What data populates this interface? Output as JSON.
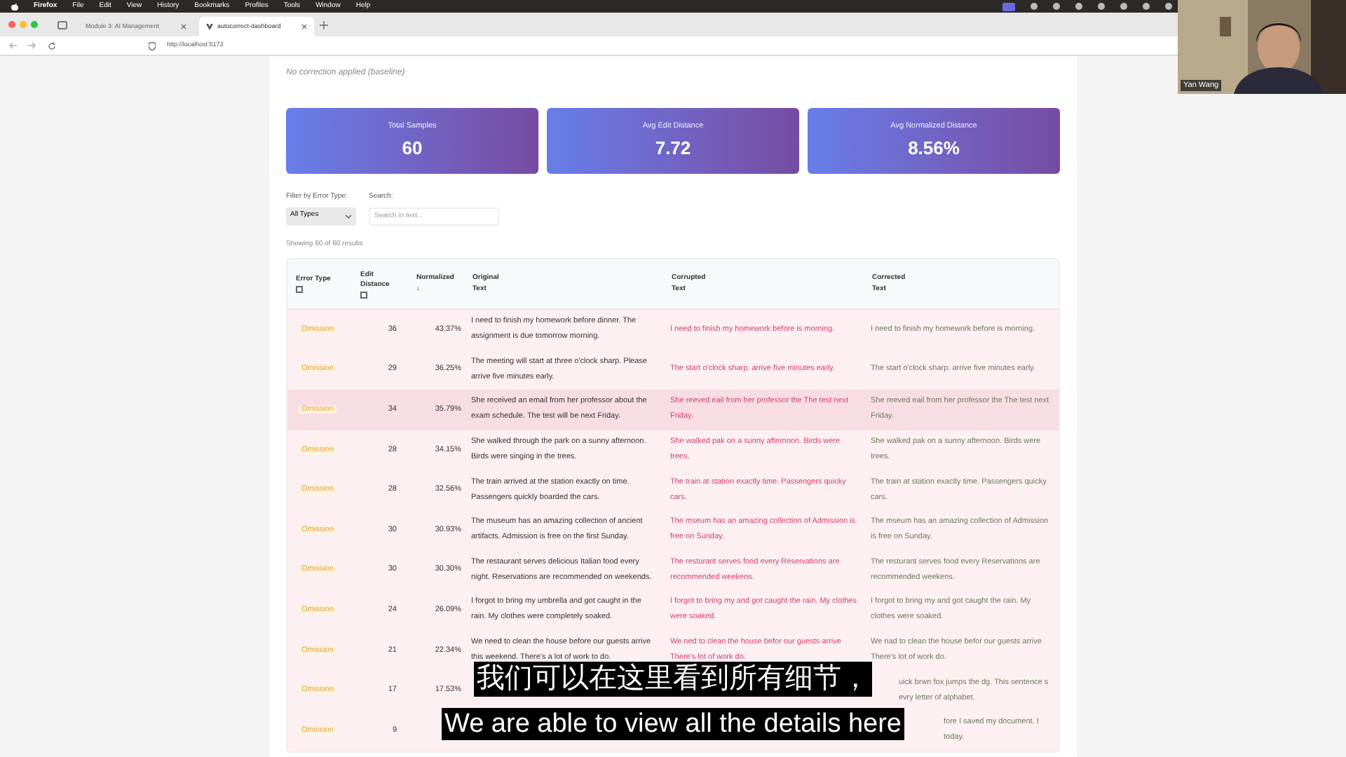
{
  "menu_bar": {
    "app": "Firefox",
    "items": [
      "File",
      "Edit",
      "View",
      "History",
      "Bookmarks",
      "Profiles",
      "Tools",
      "Window",
      "Help"
    ]
  },
  "tabs": [
    {
      "label": "Module 3: AI Management",
      "selected": false
    },
    {
      "label": "autocorrect-dashboard",
      "selected": true
    }
  ],
  "url": "http://localhost:5173",
  "page": {
    "subtitle": "No correction applied (baseline)",
    "stats": [
      {
        "label": "Total Samples",
        "value": "60"
      },
      {
        "label": "Avg Edit Distance",
        "value": "7.72"
      },
      {
        "label": "Avg Normalized Distance",
        "value": "8.56%"
      }
    ],
    "filters": {
      "type_label": "Filter by Error Type:",
      "type_value": "All Types",
      "search_label": "Search:",
      "search_placeholder": "Search in text..."
    },
    "showing": "Showing 60 of 60 results",
    "table": {
      "columns": [
        {
          "label": "Error Type",
          "sort_icon": true
        },
        {
          "label": "Edit Distance",
          "sort_icon": true
        },
        {
          "label": "Normalized",
          "sort_arrow": "↓"
        },
        {
          "label": "Original Text"
        },
        {
          "label": "Corrupted Text"
        },
        {
          "label": "Corrected Text"
        }
      ],
      "rows": [
        {
          "kind": "full",
          "highlighted": false,
          "error_type": "Omission",
          "edit_distance": "36",
          "normalized": "43.37%",
          "original": "I need to finish my homework before dinner. The assignment is due tomorrow morning.",
          "corrupted": "I need to finish my homework before is morning.",
          "corrected": "I need to finish my homework before is morning."
        },
        {
          "kind": "full",
          "highlighted": false,
          "error_type": "Omission",
          "edit_distance": "29",
          "normalized": "36.25%",
          "original": "The meeting will start at three o'clock sharp. Please arrive five minutes early.",
          "corrupted": "The start o'clock sharp. arrive five minutes early.",
          "corrected": "The start o'clock sharp. arrive five minutes early."
        },
        {
          "kind": "full",
          "highlighted": true,
          "error_type": "Omission",
          "edit_distance": "34",
          "normalized": "35.79%",
          "original": "She received an email from her professor about the exam schedule. The test will be next Friday.",
          "corrupted": "She reeved eail from her professor the The test next Friday.",
          "corrected": "She reeved eail from her professor the The test next Friday."
        },
        {
          "kind": "full",
          "highlighted": false,
          "error_type": "Omission",
          "edit_distance": "28",
          "normalized": "34.15%",
          "original": "She walked through the park on a sunny afternoon. Birds were singing in the trees.",
          "corrupted": "She walked pak on a sunny afternoon. Birds were trees.",
          "corrected": "She walked pak on a sunny afternoon. Birds were trees."
        },
        {
          "kind": "full",
          "highlighted": false,
          "error_type": "Omission",
          "edit_distance": "28",
          "normalized": "32.56%",
          "original": "The train arrived at the station exactly on time. Passengers quickly boarded the cars.",
          "corrupted": "The train at station exactly time. Passengers quicky cars.",
          "corrected": "The train at station exactly time. Passengers quicky cars."
        },
        {
          "kind": "full",
          "highlighted": false,
          "error_type": "Omission",
          "edit_distance": "30",
          "normalized": "30.93%",
          "original": "The museum has an amazing collection of ancient artifacts. Admission is free on the first Sunday.",
          "corrupted": "The mseum has an amazing collection of Admission is free on Sunday.",
          "corrected": "The mseum has an amazing collection of Admission is free on Sunday."
        },
        {
          "kind": "full",
          "highlighted": false,
          "error_type": "Omission",
          "edit_distance": "30",
          "normalized": "30.30%",
          "original": "The restaurant serves delicious Italian food every night. Reservations are recommended on weekends.",
          "corrupted": "The resturant serves food every Reservations are recommended weekens.",
          "corrected": "The resturant serves food every Reservations are recommended weekens."
        },
        {
          "kind": "full",
          "highlighted": false,
          "error_type": "Omission",
          "edit_distance": "24",
          "normalized": "26.09%",
          "original": "I forgot to bring my umbrella and got caught in the rain. My clothes were completely soaked.",
          "corrupted": "I forgot to bring my and got caught the rain. My clothes were soaked.",
          "corrected": "I forgot to bring my and got caught the rain. My clothes were soaked."
        },
        {
          "kind": "full",
          "highlighted": false,
          "error_type": "Omission",
          "edit_distance": "21",
          "normalized": "22.34%",
          "original": "We need to clean the house before our guests arrive this weekend. There's a lot of work to do.",
          "corrupted": "We ned to clean the house befor our guests arrive There's lot of work do.",
          "corrected": "We nad to clean the house befor our guests arrive There's lot of work do."
        },
        {
          "kind": "half_hidden",
          "highlighted": false,
          "error_type": "Omission",
          "edit_distance": "17",
          "normalized": "17.53%",
          "corrected": "uick brwn fox jumps the dg. This sentence s evry letter of alphabet."
        },
        {
          "kind": "hidden",
          "highlighted": false,
          "error_type": "Omission",
          "edit_distance": "9",
          "corrected": "fore I saved my document. I today."
        }
      ]
    }
  },
  "webcam": {
    "name": "Yan Wang"
  },
  "captions": [
    "我们可以在这里看到所有细节，",
    "We are able to view all the details here"
  ]
}
